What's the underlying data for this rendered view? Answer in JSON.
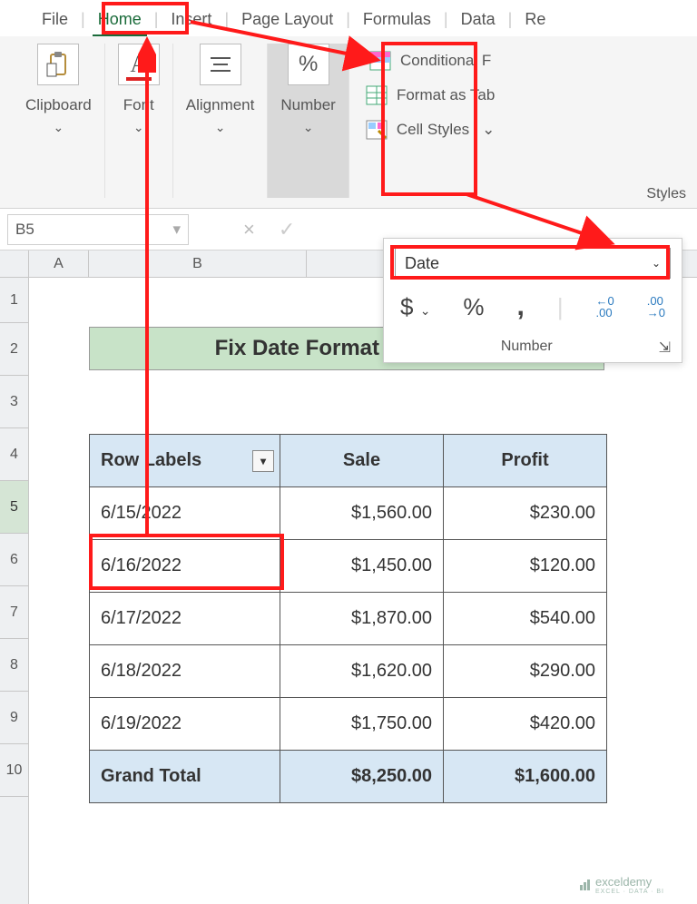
{
  "tabs": {
    "file": "File",
    "home": "Home",
    "insert": "Insert",
    "pagelayout": "Page Layout",
    "formulas": "Formulas",
    "data": "Data",
    "review": "Re"
  },
  "ribbon": {
    "clipboard": "Clipboard",
    "font": "Font",
    "alignment": "Alignment",
    "number": "Number",
    "conditional": "Conditional F",
    "format_table": "Format as Tab",
    "cell_styles": "Cell Styles",
    "styles_label": "Styles"
  },
  "namebox": "B5",
  "popover": {
    "selected": "Date",
    "currency": "$",
    "percent": "%",
    "comma": ",",
    "inc_dec_a": "←0\n.00",
    "inc_dec_b": ".00\n→0",
    "footer": "Number"
  },
  "columns": {
    "a": "A",
    "b": "B"
  },
  "rows": [
    "1",
    "2",
    "3",
    "4",
    "5",
    "6",
    "7",
    "8",
    "9",
    "10"
  ],
  "banner": "Fix Date Format Manually",
  "table": {
    "hdr": {
      "rowlabels": "Row Labels",
      "sale": "Sale",
      "profit": "Profit"
    },
    "rows": [
      {
        "d": "6/15/2022",
        "s": "$1,560.00",
        "p": "$230.00"
      },
      {
        "d": "6/16/2022",
        "s": "$1,450.00",
        "p": "$120.00"
      },
      {
        "d": "6/17/2022",
        "s": "$1,870.00",
        "p": "$540.00"
      },
      {
        "d": "6/18/2022",
        "s": "$1,620.00",
        "p": "$290.00"
      },
      {
        "d": "6/19/2022",
        "s": "$1,750.00",
        "p": "$420.00"
      }
    ],
    "total": {
      "label": "Grand Total",
      "s": "$8,250.00",
      "p": "$1,600.00"
    }
  },
  "watermark": {
    "brand": "exceldemy",
    "sub": "EXCEL · DATA · BI"
  }
}
